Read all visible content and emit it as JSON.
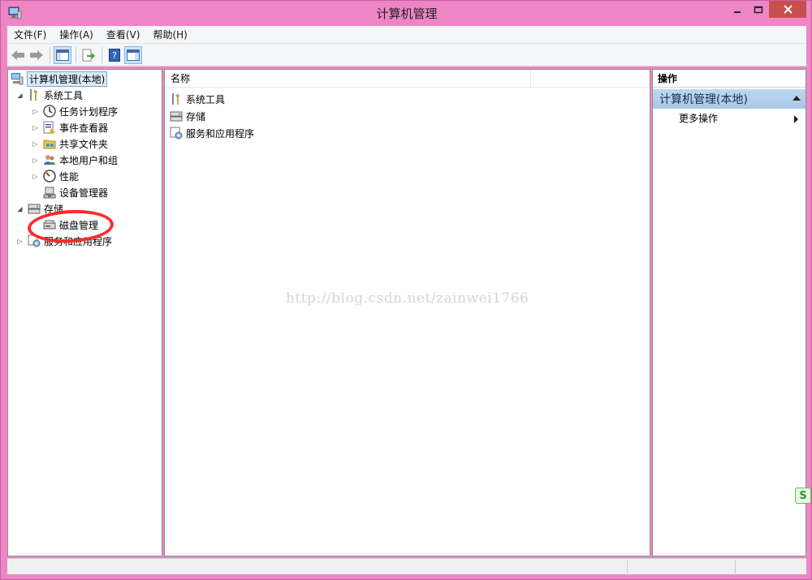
{
  "window": {
    "title": "计算机管理"
  },
  "menu": [
    "文件(F)",
    "操作(A)",
    "查看(V)",
    "帮助(H)"
  ],
  "tree": {
    "root": "计算机管理(本地)",
    "system_tools": "系统工具",
    "task_scheduler": "任务计划程序",
    "event_viewer": "事件查看器",
    "shared_folders": "共享文件夹",
    "local_users": "本地用户和组",
    "performance": "性能",
    "device_manager": "设备管理器",
    "storage": "存储",
    "disk_management": "磁盘管理",
    "services_apps": "服务和应用程序"
  },
  "list": {
    "column_name": "名称",
    "items": [
      "系统工具",
      "存储",
      "服务和应用程序"
    ]
  },
  "actions": {
    "header": "操作",
    "section": "计算机管理(本地)",
    "more": "更多操作"
  },
  "watermark": "http://blog.csdn.net/zainwei1766",
  "badge": "S"
}
